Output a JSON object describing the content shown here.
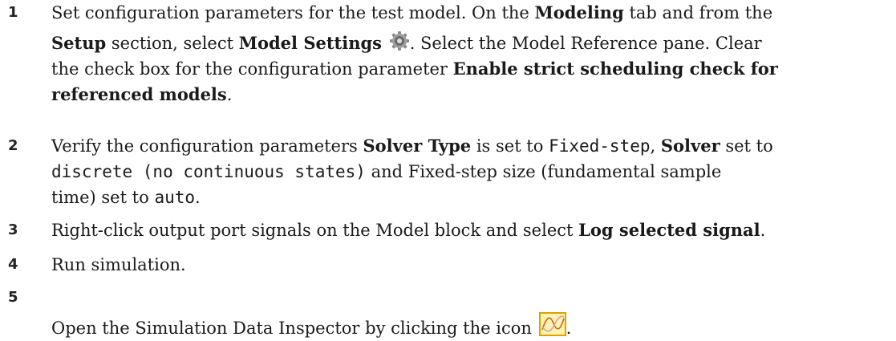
{
  "steps": [
    {
      "number": "1",
      "line1_text": "Set configuration parameters for the test model. On the ",
      "line1_bold": "Modeling",
      "line1_end": " tab and from the",
      "line2_bold1": "Setup",
      "line2_text1": " section, select ",
      "line2_bold2": "Model Settings",
      "gear_icon": "gear-icon",
      "line2_text2": ". Select the Model Reference pane. Clear",
      "line3_text": "the check box for the configuration parameter ",
      "line3_bold": "Enable strict scheduling check for",
      "line4_bold": "referenced models",
      "line4_end": "."
    },
    {
      "number": "2",
      "line1_text1": "Verify the configuration parameters ",
      "line1_bold1": "Solver Type",
      "line1_text2": " is set to ",
      "line1_mono": "Fixed-step",
      "line1_text3": ", ",
      "line1_bold2": "Solver",
      "line1_text4": " set to",
      "line2_mono": "discrete (no continuous states)",
      "line2_text": " and Fixed-step size (fundamental sample",
      "line3_text": "time) set to ",
      "line3_mono": "auto",
      "line3_end": "."
    },
    {
      "number": "3",
      "text": "Right-click output port signals on the Model block and select ",
      "bold": "Log selected signal",
      "end": "."
    },
    {
      "number": "4",
      "text": "Run simulation."
    },
    {
      "number": "5",
      "text": "Open the Simulation Data Inspector by clicking the icon",
      "sdi_icon": "simulation-data-inspector-icon",
      "end": "."
    }
  ],
  "colors": {
    "text": "#1a1a1a",
    "icon_border": "#e0a000",
    "icon_fill": "#fff3b0",
    "icon_curve": "#c86428"
  }
}
